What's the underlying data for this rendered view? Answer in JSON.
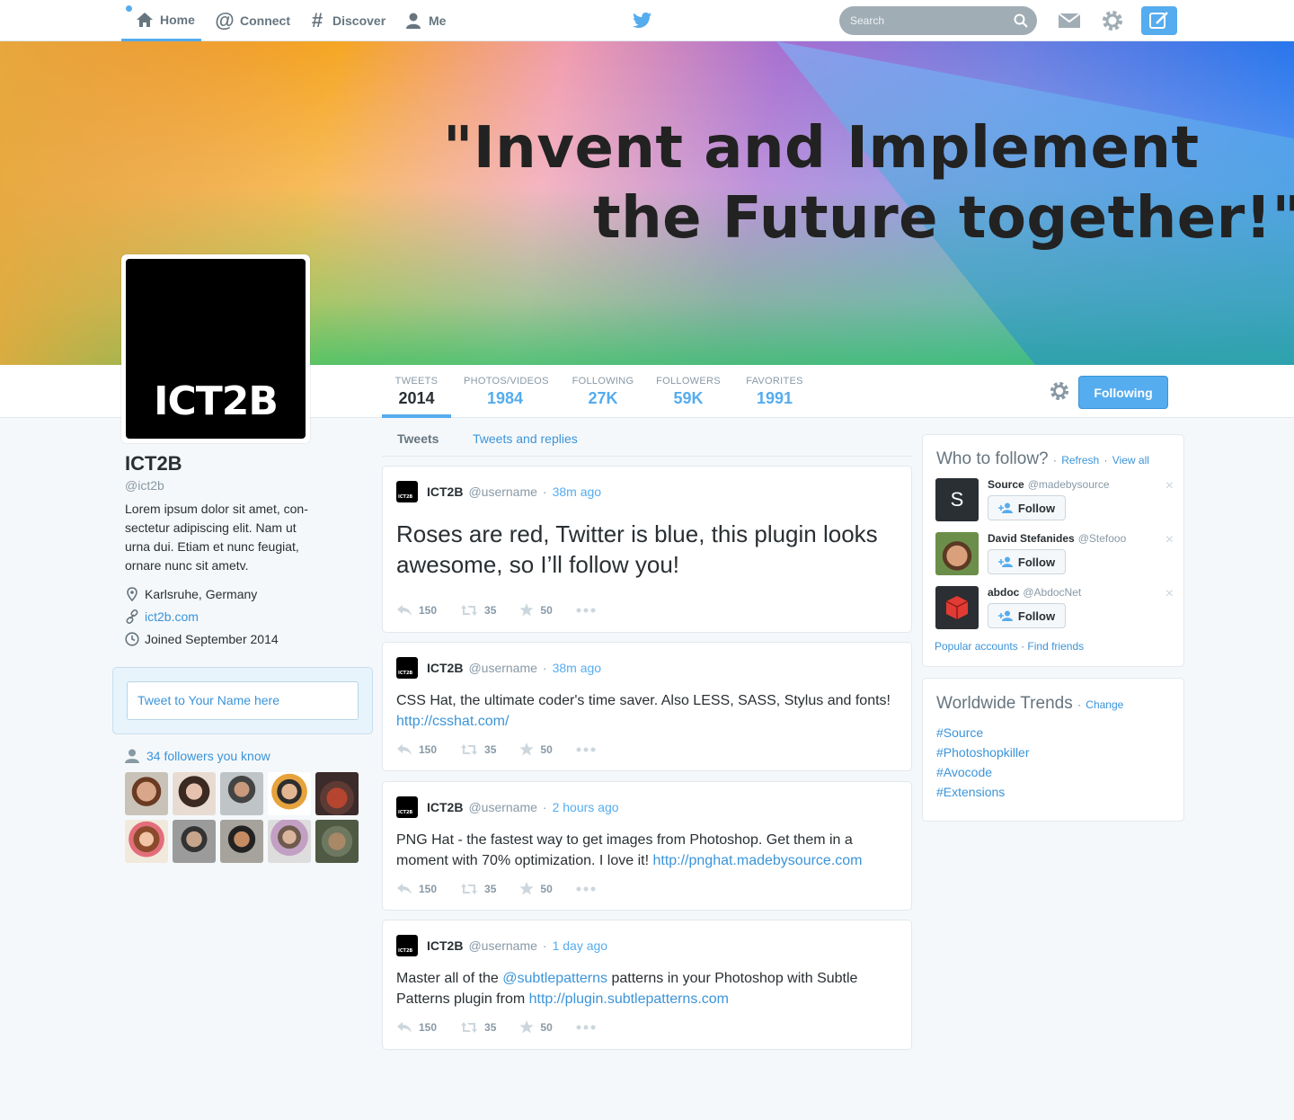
{
  "nav": {
    "home": "Home",
    "connect": "Connect",
    "discover": "Discover",
    "me": "Me",
    "search_placeholder": "Search"
  },
  "header": {
    "quote_line1": "\"Invent and Implement",
    "quote_line2": "the Future together!\""
  },
  "avatar_logo": "ICT2B",
  "stats": [
    {
      "label": "TWEETS",
      "value": "2014"
    },
    {
      "label": "PHOTOS/VIDEOS",
      "value": "1984"
    },
    {
      "label": "FOLLOWING",
      "value": "27K"
    },
    {
      "label": "FOLLOWERS",
      "value": "59K"
    },
    {
      "label": "FAVORITES",
      "value": "1991"
    }
  ],
  "following_button": "Following",
  "profile": {
    "name": "ICT2B",
    "handle": "@ict2b",
    "bio": "Lorem ipsum dolor sit amet, con-sectetur adipiscing elit. Nam ut urna dui. Etiam et nunc feugiat, ornare nunc sit ametv.",
    "location": "Karlsruhe, Germany",
    "website": "ict2b.com",
    "joined": "Joined September 2014"
  },
  "tweet_box_placeholder": "Tweet to Your Name here",
  "followers_you_know": "34 followers you know",
  "timeline_tabs": {
    "tweets": "Tweets",
    "replies": "Tweets and replies"
  },
  "tweets": [
    {
      "avatar": "ICT2B",
      "name": "ICT2B",
      "handle": "@username",
      "time": "38m ago",
      "text": "Roses are red, Twitter is blue, this plugin looks awesome, so I’ll follow you!",
      "replies": "150",
      "retweets": "35",
      "favorites": "50"
    },
    {
      "avatar": "ICT2B",
      "name": "ICT2B",
      "handle": "@username",
      "time": "38m ago",
      "text": "CSS Hat, the ultimate coder's time saver. Also LESS, SASS, Stylus and fonts!",
      "link": "http://csshat.com/",
      "replies": "150",
      "retweets": "35",
      "favorites": "50"
    },
    {
      "avatar": "ICT2B",
      "name": "ICT2B",
      "handle": "@username",
      "time": "2 hours ago",
      "text": "PNG Hat - the fastest way to get images from Photoshop. Get them in a moment with 70% optimization. I love it!",
      "link": "http://pnghat.madebysource.com",
      "replies": "150",
      "retweets": "35",
      "favorites": "50"
    },
    {
      "avatar": "ICT2B",
      "name": "ICT2B",
      "handle": "@username",
      "time": "1 day ago",
      "text_before": "Master all of the",
      "mention": "@subtlepatterns",
      "text_after": "patterns in your Photoshop with Subtle Patterns plugin from",
      "link": "http://plugin.subtlepatterns.com",
      "replies": "150",
      "retweets": "35",
      "favorites": "50"
    }
  ],
  "who_to_follow": {
    "title": "Who to follow?",
    "refresh": "Refresh",
    "view_all": "View all",
    "follow_label": "Follow",
    "close": "×",
    "separator": "·",
    "accounts": [
      {
        "name": "Source",
        "handle": "@madebysource",
        "avatar_letter": "S"
      },
      {
        "name": "David Stefanides",
        "handle": "@Stefooo"
      },
      {
        "name": "abdoc",
        "handle": "@AbdocNet"
      }
    ],
    "popular": "Popular accounts",
    "find_friends": "Find friends"
  },
  "trends": {
    "title": "Worldwide Trends",
    "change": "Change",
    "items": [
      "#Source",
      "#Photoshopkiller",
      "#Avocode",
      "#Extensions"
    ]
  },
  "colors": {
    "accent": "#55acee",
    "link": "#3b94d9",
    "text": "#292f33",
    "muted": "#8899a6",
    "background": "#f5f8fa"
  }
}
